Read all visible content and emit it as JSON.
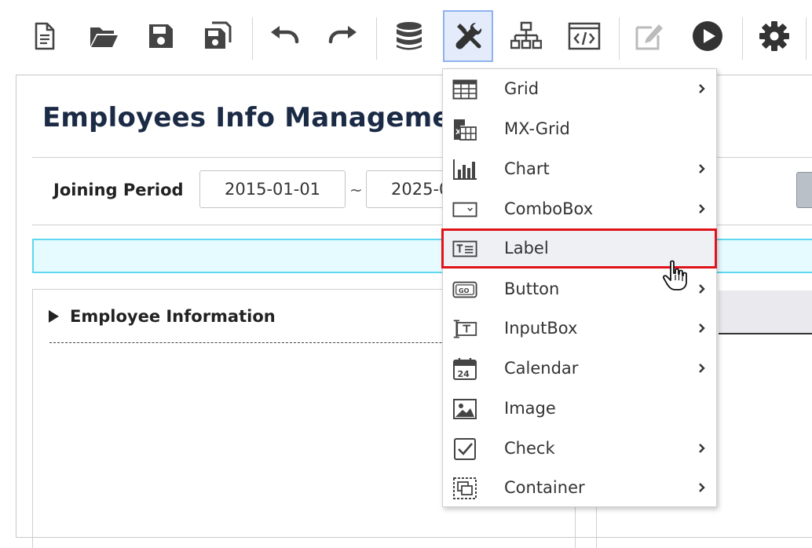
{
  "toolbar": {
    "buttons": [
      {
        "icon": "new-file-icon"
      },
      {
        "icon": "open-folder-icon"
      },
      {
        "icon": "save-icon"
      },
      {
        "icon": "save-as-icon"
      },
      {
        "icon": "undo-icon"
      },
      {
        "icon": "redo-icon"
      },
      {
        "icon": "database-icon"
      },
      {
        "icon": "components-tools-icon",
        "active": true
      },
      {
        "icon": "hierarchy-icon"
      },
      {
        "icon": "code-view-icon"
      },
      {
        "icon": "edit-icon",
        "disabled": true
      },
      {
        "icon": "run-icon"
      },
      {
        "icon": "settings-icon"
      }
    ]
  },
  "canvas": {
    "page_title": "Employees Info Management",
    "search": {
      "label": "Joining Period",
      "from_date": "2015-01-01",
      "separator": "~",
      "to_date": "2025-0"
    },
    "section": {
      "title": "Employee Information"
    }
  },
  "menu": {
    "items": [
      {
        "label": "Grid",
        "icon": "grid-icon",
        "submenu": true
      },
      {
        "label": "MX-Grid",
        "icon": "mx-grid-icon",
        "submenu": false
      },
      {
        "label": "Chart",
        "icon": "chart-icon",
        "submenu": true
      },
      {
        "label": "ComboBox",
        "icon": "combobox-icon",
        "submenu": true
      },
      {
        "label": "Label",
        "icon": "label-icon",
        "submenu": false,
        "highlighted": true
      },
      {
        "label": "Button",
        "icon": "button-icon",
        "submenu": true
      },
      {
        "label": "InputBox",
        "icon": "inputbox-icon",
        "submenu": true
      },
      {
        "label": "Calendar",
        "icon": "calendar-icon",
        "submenu": true
      },
      {
        "label": "Image",
        "icon": "image-icon",
        "submenu": false
      },
      {
        "label": "Check",
        "icon": "check-icon",
        "submenu": true
      },
      {
        "label": "Container",
        "icon": "container-icon",
        "submenu": true
      }
    ]
  },
  "colors": {
    "highlight_border": "#e0131b",
    "active_tool_bg": "#e4ecfb",
    "banner_border": "#5fd7f0",
    "title_color": "#1b2a45"
  }
}
